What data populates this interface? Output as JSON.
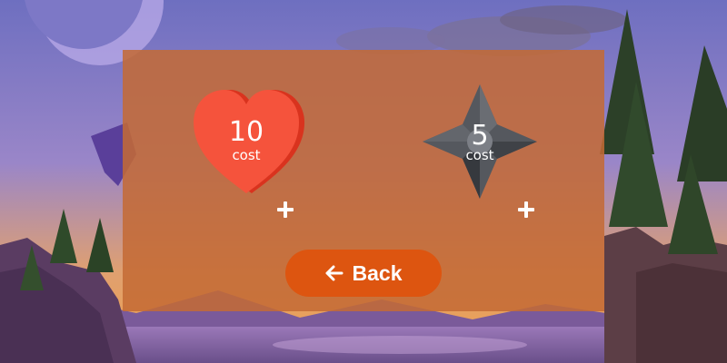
{
  "resources": {
    "heart": {
      "icon": "heart-icon",
      "value": "10",
      "label": "cost",
      "color": "#f5533c"
    },
    "star": {
      "icon": "shuriken-icon",
      "value": "5",
      "label": "cost",
      "color": "#4a4d52"
    }
  },
  "back_button": {
    "label": "Back",
    "icon": "arrow-left-icon",
    "color": "#dd5510"
  },
  "colors": {
    "panel": "#c46a34",
    "plus": "#ffffff"
  }
}
